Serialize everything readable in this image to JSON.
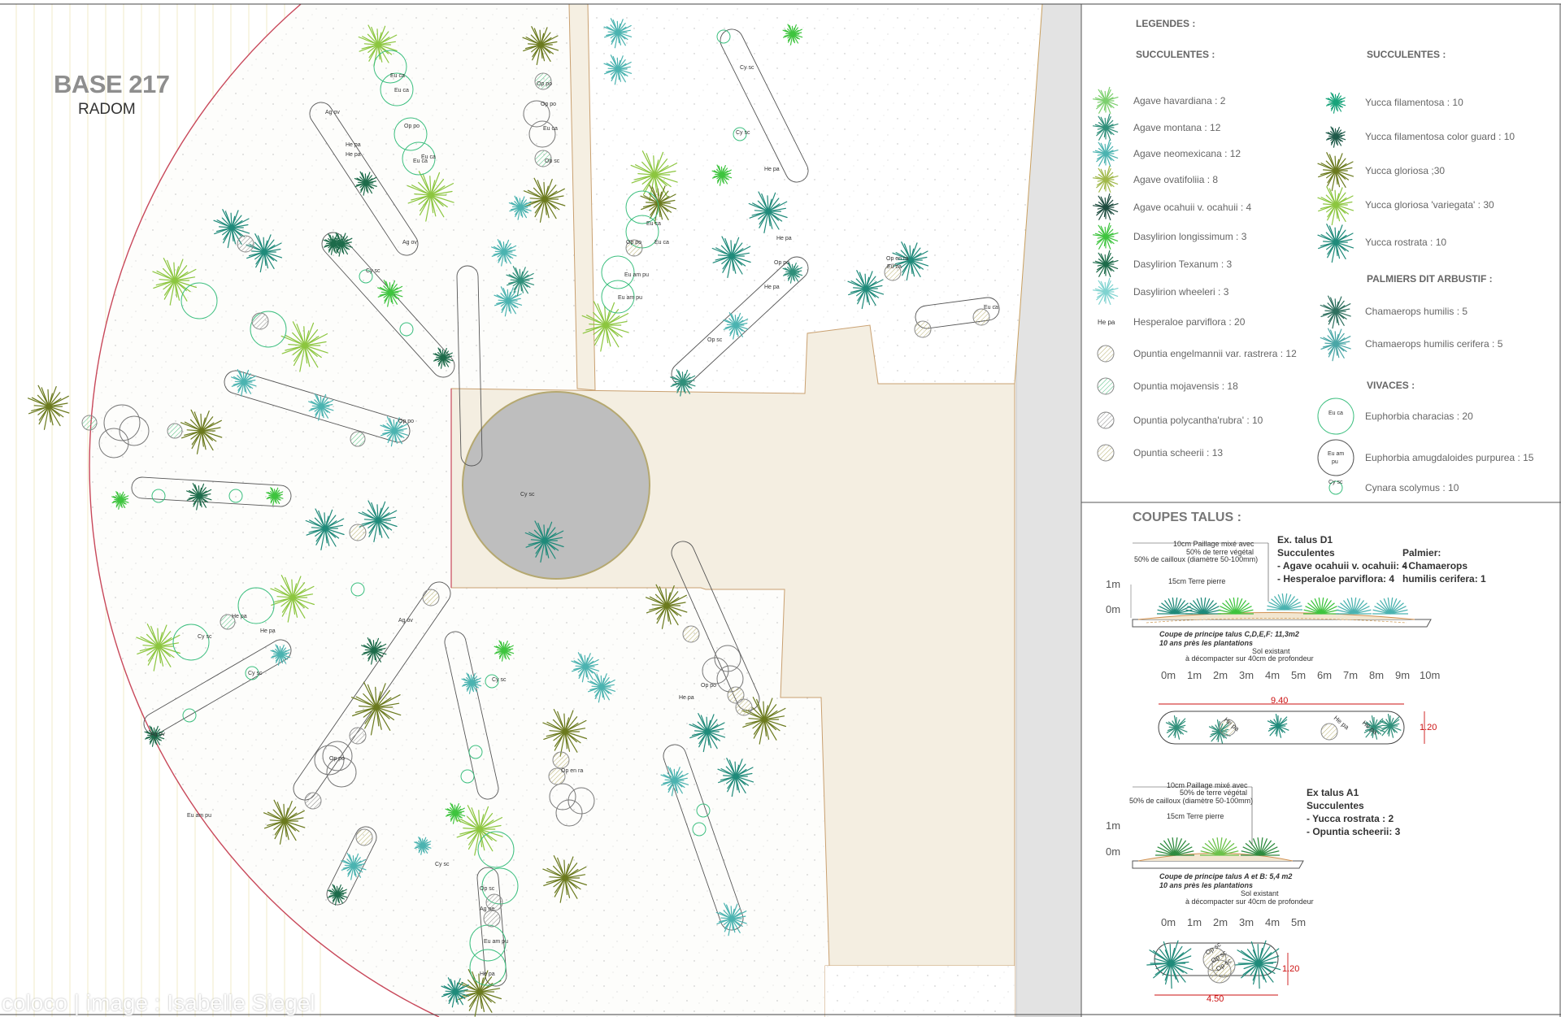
{
  "site": {
    "title": "BASE 217",
    "subtitle": "RADOM"
  },
  "credit": "coloco | image : Isabelle Siegel",
  "legend": {
    "heading": "LEGENDES :",
    "succ_heading_1": "SUCCULENTES :",
    "succ_heading_2": "SUCCULENTES :",
    "palm_heading": "PALMIERS DIT ARBUSTIF :",
    "vivaces_heading": "VIVACES :",
    "col1": [
      {
        "label": "Agave havardiana : 2",
        "icon": "agave-havardiana-icon",
        "color": "#7ccf6e"
      },
      {
        "label": "Agave montana : 12",
        "icon": "agave-montana-icon",
        "color": "#2f8f7a"
      },
      {
        "label": "Agave neomexicana : 12",
        "icon": "agave-neomexicana-icon",
        "color": "#4bb3b0"
      },
      {
        "label": "Agave ovatifoliia : 8",
        "icon": "agave-ovatifolia-icon",
        "color": "#a0b84a"
      },
      {
        "label": "Agave ocahuii v. ocahuii : 4",
        "icon": "agave-ocahuii-icon",
        "color": "#1c4b3e"
      },
      {
        "label": "Dasylirion longissimum : 3",
        "icon": "dasylirion-longissimum-icon",
        "color": "#3ec43e"
      },
      {
        "label": "Dasylirion Texanum : 3",
        "icon": "dasylirion-texanum-icon",
        "color": "#1d6b4a"
      },
      {
        "label": "Dasylirion wheeleri : 3",
        "icon": "dasylirion-wheeleri-icon",
        "color": "#7fd3d0"
      },
      {
        "label": "Hesperaloe parviflora : 20",
        "icon": "hesperaloe-icon",
        "color": "#555555"
      },
      {
        "label": "Opuntia engelmannii var. rastrera : 12",
        "icon": "opuntia-engelmannii-icon",
        "color": "#b8b07a"
      },
      {
        "label": "Opuntia mojavensis : 18",
        "icon": "opuntia-mojavensis-icon",
        "color": "#4fbf7f"
      },
      {
        "label": "Opuntia polycantha'rubra' : 10",
        "icon": "opuntia-polycantha-icon",
        "color": "#777777"
      },
      {
        "label": "Opuntia scheerii : 13",
        "icon": "opuntia-scheerii-icon",
        "color": "#a8a070"
      }
    ],
    "col2": [
      {
        "label": "Yucca filamentosa : 10",
        "icon": "yucca-filamentosa-icon",
        "color": "#17a37a"
      },
      {
        "label": "Yucca filamentosa color guard : 10",
        "icon": "yucca-color-guard-icon",
        "color": "#1f5a4a"
      },
      {
        "label": "Yucca gloriosa ;30",
        "icon": "yucca-gloriosa-icon",
        "color": "#6b7a1e"
      },
      {
        "label": "Yucca gloriosa 'variegata' : 30",
        "icon": "yucca-variegata-icon",
        "color": "#8cc63f"
      },
      {
        "label": "Yucca rostrata  : 10",
        "icon": "yucca-rostrata-icon",
        "color": "#1f8a7a"
      }
    ],
    "palms": [
      {
        "label": "Chamaerops humilis : 5",
        "icon": "chamaerops-icon",
        "color": "#2e6f5e"
      },
      {
        "label": "Chamaerops humilis cerifera : 5",
        "icon": "chamaerops-cerifera-icon",
        "color": "#4aa6a6"
      }
    ],
    "vivaces": [
      {
        "label": "Euphorbia characias : 20",
        "icon": "euphorbia-characias-icon",
        "color": "#3cbf7f",
        "code": "Eu ca"
      },
      {
        "label": "Euphorbia amugdaloides purpurea : 15",
        "icon": "euphorbia-amygdaloides-icon",
        "color": "#555555",
        "code": "Eu am pu"
      },
      {
        "label": "Cynara scolymus : 10",
        "icon": "cynara-icon",
        "color": "#3cbf7f",
        "code": "Cy sc"
      }
    ]
  },
  "sections": {
    "heading": "COUPES TALUS :",
    "d1": {
      "title_lines": [
        "Ex. talus D1",
        "Succulentes",
        "- Agave ocahuii v. ocahuii: 4",
        "- Hesperaloe parviflora: 4"
      ],
      "palm_lines": [
        "Palmier:",
        "- Chamaerops",
        "humilis cerifera: 1"
      ],
      "ann": [
        "10cm Paillage mixé avec",
        "50% de terre végétal",
        "50% de cailloux (diamètre 50-100mm)",
        "15cm Terre pierre"
      ],
      "caption": [
        "Coupe de principe talus C,D,E,F: 11,3m2",
        "10 ans près les plantations"
      ],
      "soil": [
        "Sol existant",
        "à décompacter sur 40cm de profondeur"
      ],
      "scale": [
        "0m",
        "1m",
        "2m",
        "3m",
        "4m",
        "5m",
        "6m",
        "7m",
        "8m",
        "9m",
        "10m"
      ],
      "dim_len": "9.40",
      "dim_wid": "1.20",
      "codes": [
        "He pa",
        "He pa",
        "He pa"
      ]
    },
    "a1": {
      "title_lines": [
        "Ex talus A1",
        "Succulentes",
        "- Yucca rostrata : 2",
        "- Opuntia scheerii: 3"
      ],
      "ann": [
        "10cm Paillage mixé avec",
        "50% de terre végétal",
        "50% de cailloux (diamètre 50-100mm)",
        "15cm Terre pierre"
      ],
      "caption": [
        "Coupe de principe talus A et B: 5,4 m2",
        "10 ans près les plantations"
      ],
      "soil": [
        "Sol existant",
        "à décompacter sur 40cm de profondeur"
      ],
      "scale": [
        "0m",
        "1m",
        "2m",
        "3m",
        "4m",
        "5m"
      ],
      "dim_len": "4.50",
      "dim_wid": "1.20",
      "codes": [
        "Op sc",
        "Op sc",
        "Op sc"
      ]
    },
    "height_top": "1m",
    "height_bottom": "0m"
  },
  "plan_codes": [
    "Ag ov",
    "Eu ca",
    "Eu ca",
    "Op po",
    "Eu ca",
    "Eu ca",
    "He pa",
    "He pa",
    "Cy sc",
    "Ag ov",
    "Op po",
    "Op po",
    "Eu ca",
    "Op sc",
    "Eu ca",
    "Eu ca",
    "Eu am pu",
    "Eu am pu",
    "Op po",
    "Cy sc",
    "Cy sc",
    "Cy sc",
    "He pa",
    "He pa",
    "He pa",
    "Op po",
    "Op sc",
    "Eu ca",
    "Op po",
    "Eu ca",
    "Cy sc",
    "He pa",
    "He pa",
    "Ag ov",
    "Op po",
    "Eu am pu",
    "Ag ov",
    "Cy sc",
    "Cy sc",
    "Op en ra",
    "Eu am pu",
    "He pa",
    "He pa",
    "Op po",
    "Ag ne",
    "Op sc",
    "Cy sc",
    "Op en ra"
  ]
}
